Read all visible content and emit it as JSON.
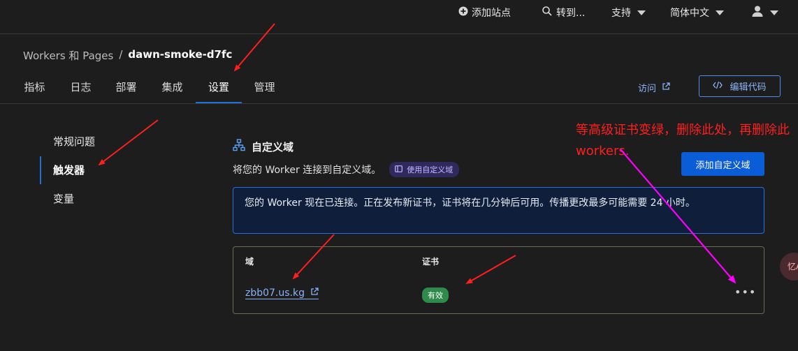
{
  "topbar": {
    "add_site": "添加站点",
    "goto": "转到...",
    "support": "支持",
    "language": "简体中文"
  },
  "breadcrumb": {
    "parent": "Workers 和 Pages",
    "separator": "/",
    "current": "dawn-smoke-d7fc"
  },
  "tabs": [
    {
      "label": "指标"
    },
    {
      "label": "日志"
    },
    {
      "label": "部署"
    },
    {
      "label": "集成"
    },
    {
      "label": "设置",
      "active": true
    },
    {
      "label": "管理"
    }
  ],
  "actions": {
    "visit": "访问",
    "edit_code": "编辑代码"
  },
  "sidebar": {
    "items": [
      {
        "label": "常规问题"
      },
      {
        "label": "触发器",
        "active": true
      },
      {
        "label": "变量"
      }
    ]
  },
  "custom_domain": {
    "title": "自定义域",
    "description": "将您的 Worker 连接到自定义域。",
    "docs_pill": "使用自定义域",
    "add_button": "添加自定义域",
    "info": "您的 Worker 现在已连接。正在发布新证书，证书将在几分钟后可用。传播更改最多可能需要 24 小时。",
    "table": {
      "headers": {
        "domain": "域",
        "certificate": "证书"
      },
      "rows": [
        {
          "domain": "zbb07.us.kg",
          "status": "有效"
        }
      ]
    }
  },
  "annotation": {
    "text": "等高级证书变绿，删除此处，再删除此workers."
  },
  "floating": {
    "label": "忆A"
  },
  "colors": {
    "accent": "#1f6fd6",
    "link": "#8ab4f8",
    "primary_button": "#0b5cd7",
    "success": "#2e8b4b",
    "annotation_red": "#ff1f1f",
    "annotation_magenta": "#ff00ff"
  },
  "icons": [
    "plus-circle-icon",
    "search-icon",
    "user-icon",
    "external-link-icon",
    "code-icon",
    "sitemap-icon",
    "book-icon",
    "more-horizontal-icon"
  ]
}
